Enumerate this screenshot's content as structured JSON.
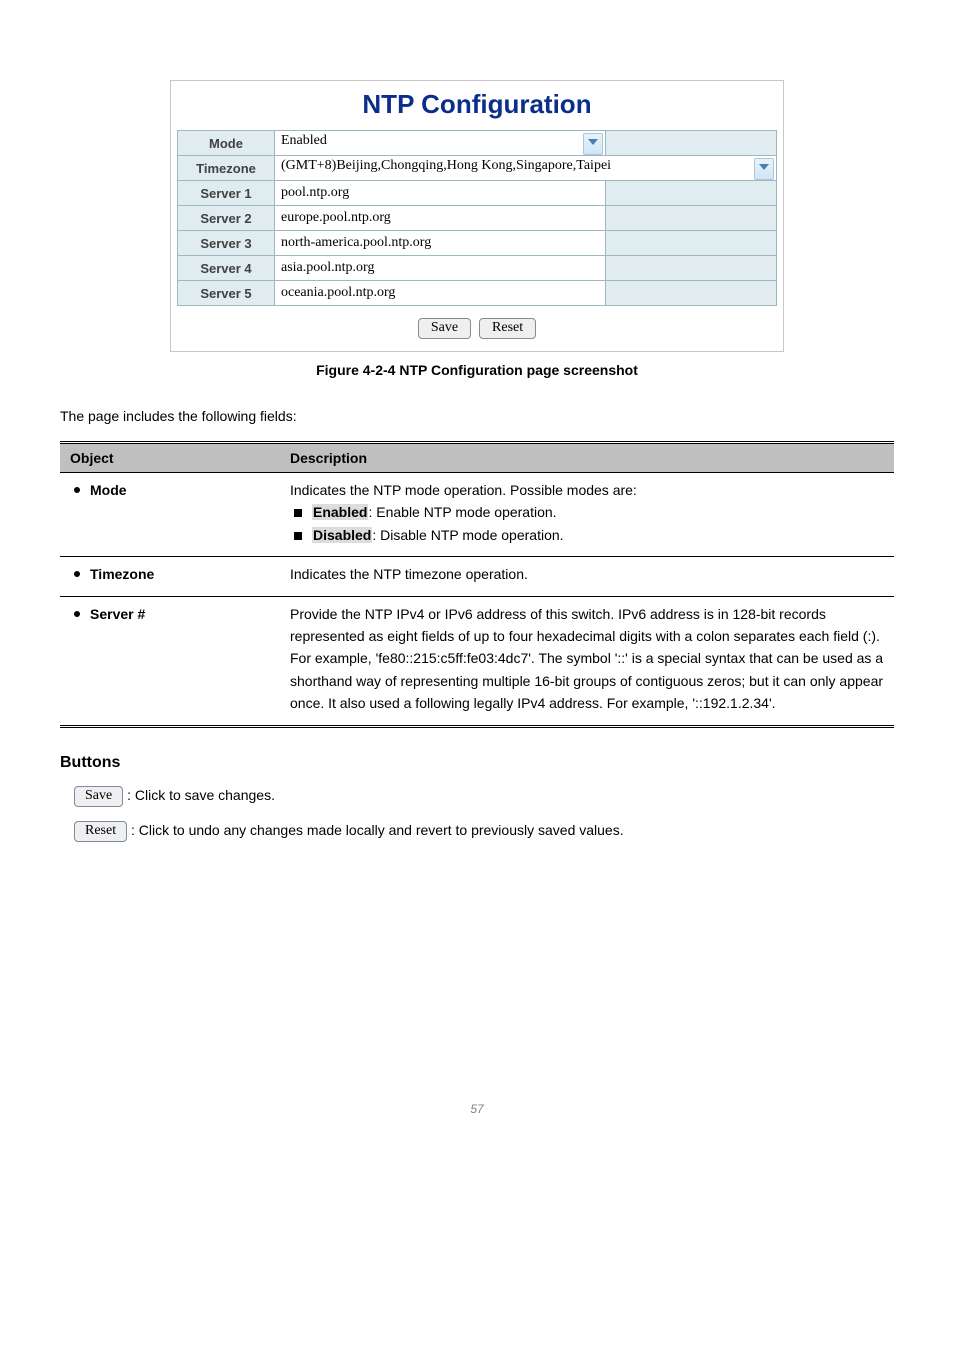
{
  "figure": {
    "title": "NTP Configuration",
    "rows": {
      "mode": {
        "label": "Mode",
        "value": "Enabled",
        "type": "select",
        "buffer": true
      },
      "tz": {
        "label": "Timezone",
        "value": "(GMT+8)Beijing,Chongqing,Hong Kong,Singapore,Taipei",
        "type": "select"
      },
      "s1": {
        "label": "Server 1",
        "value": "pool.ntp.org"
      },
      "s2": {
        "label": "Server 2",
        "value": "europe.pool.ntp.org"
      },
      "s3": {
        "label": "Server 3",
        "value": "north-america.pool.ntp.org"
      },
      "s4": {
        "label": "Server 4",
        "value": "asia.pool.ntp.org"
      },
      "s5": {
        "label": "Server 5",
        "value": "oceania.pool.ntp.org"
      }
    },
    "save": "Save",
    "reset": "Reset",
    "caption": "Figure 4-2-4 NTP Configuration page screenshot"
  },
  "intro": "The page includes the following fields:",
  "table": {
    "h1": "Object",
    "h2": "Description",
    "r1": {
      "obj": "Mode",
      "lead": "Indicates the NTP mode operation. Possible modes are:",
      "o1k": "Enabled",
      "o1v": ": Enable NTP mode operation.",
      "o2k": "Disabled",
      "o2v": ": Disable NTP mode operation."
    },
    "r2": {
      "obj": "Timezone",
      "desc": "Indicates the NTP timezone operation."
    },
    "r3": {
      "obj": "Server #",
      "p1a": "Provide the NTP IPv4 or IPv6 address of this switch. IPv6 address is in 128-bit records represented as eight fields of up to four hexadecimal digits with a colon separates each field (:). For example, '",
      "p1b": "fe80::215:c5ff:fe03:4dc7",
      "p1c": "'. The symbol '::' is a special syntax that can be used as a shorthand way of representing multiple 16-bit groups of contiguous zeros; but it can only appear once. It also used a following legally IPv4 address. For example, '",
      "p1d": "::192.1.2.34",
      "p1e": "'."
    }
  },
  "buttons_head": "Buttons",
  "save_line": ": Click to save changes.",
  "reset_line": ": Click to undo any changes made locally and revert to previously saved values.",
  "footer": "57"
}
